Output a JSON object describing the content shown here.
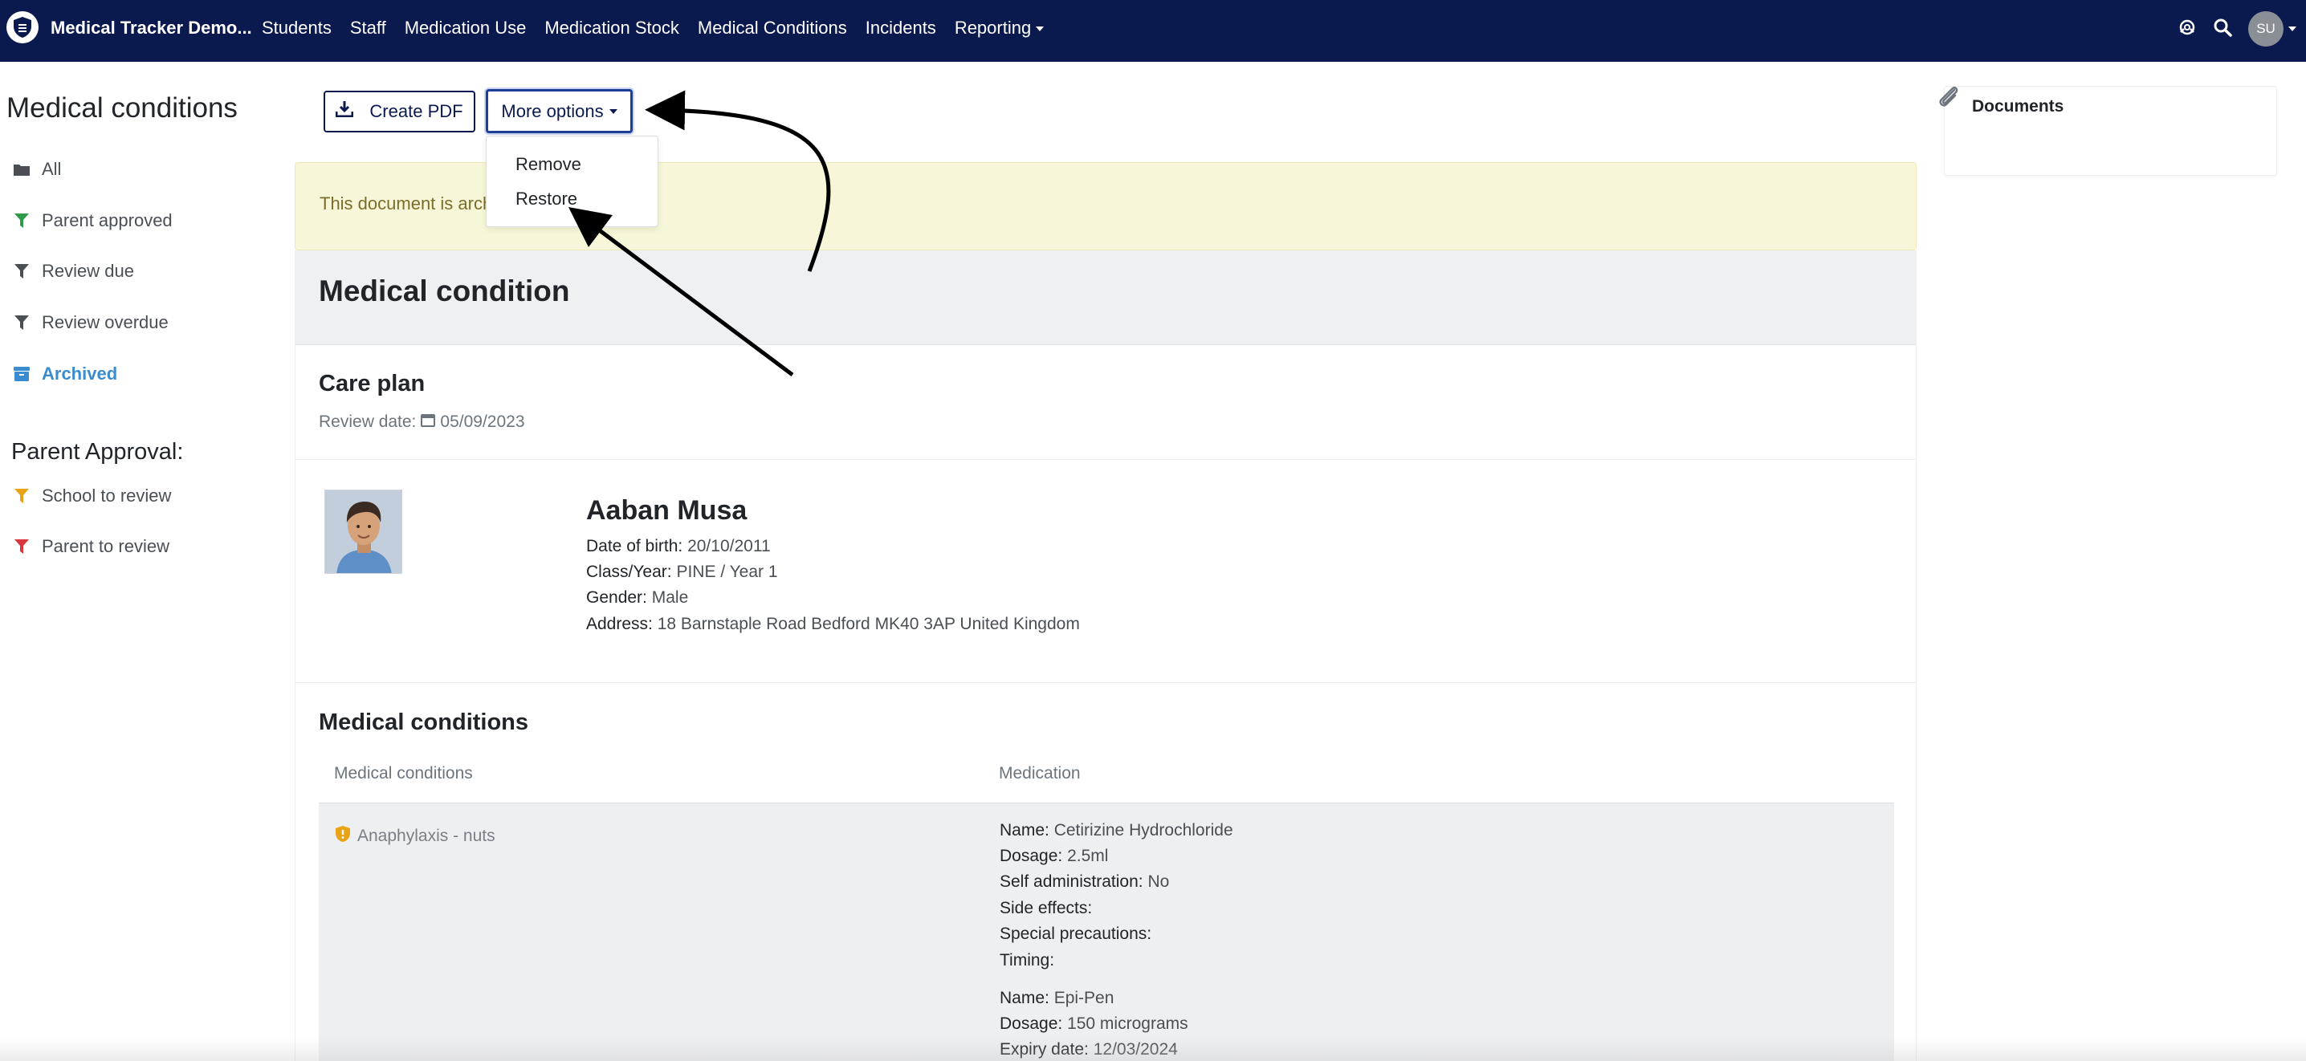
{
  "navbar": {
    "brand": "Medical Tracker Demo...",
    "links": [
      "Students",
      "Staff",
      "Medication Use",
      "Medication Stock",
      "Medical Conditions",
      "Incidents",
      "Reporting"
    ],
    "avatar_initials": "SU",
    "icons": [
      "shield-logo-icon",
      "help-icon",
      "search-icon"
    ]
  },
  "sidebar": {
    "title": "Medical conditions",
    "items": [
      {
        "label": "All",
        "icon": "folder-icon",
        "color": "#4a4f55"
      },
      {
        "label": "Parent approved",
        "icon": "filter-icon",
        "color": "#2e9a4a"
      },
      {
        "label": "Review due",
        "icon": "filter-icon",
        "color": "#4a4f55"
      },
      {
        "label": "Review overdue",
        "icon": "filter-icon",
        "color": "#4a4f55"
      },
      {
        "label": "Archived",
        "icon": "archive-icon",
        "color": "#3b8ccf"
      }
    ],
    "approval_heading": "Parent Approval:",
    "approval_items": [
      {
        "label": "School to review",
        "icon": "filter-icon",
        "color": "#e8a317"
      },
      {
        "label": "Parent to review",
        "icon": "filter-icon",
        "color": "#d9363e"
      }
    ]
  },
  "toolbar": {
    "create_pdf": "Create PDF",
    "more_options": "More options",
    "dropdown": [
      "Remove",
      "Restore"
    ]
  },
  "alert": {
    "text": "This document is arch"
  },
  "card": {
    "title": "Medical condition",
    "care_plan": "Care plan",
    "review_label": "Review date:",
    "review_date": "05/09/2023",
    "student": {
      "name": "Aaban Musa",
      "dob_label": "Date of birth:",
      "dob": "20/10/2011",
      "class_label": "Class/Year:",
      "class": "PINE / Year 1",
      "gender_label": "Gender:",
      "gender": "Male",
      "address_label": "Address:",
      "address": "18 Barnstaple Road Bedford MK40 3AP United Kingdom"
    },
    "conditions_title": "Medical conditions",
    "col_conditions": "Medical conditions",
    "col_medication": "Medication",
    "condition": "Anaphylaxis - nuts",
    "medications": [
      {
        "name_label": "Name:",
        "name": "Cetirizine Hydrochloride",
        "dosage_label": "Dosage:",
        "dosage": "2.5ml",
        "self_label": "Self administration:",
        "self": "No",
        "side_label": "Side effects:",
        "special_label": "Special precautions:",
        "timing_label": "Timing:"
      },
      {
        "name_label": "Name:",
        "name": "Epi-Pen",
        "dosage_label": "Dosage:",
        "dosage": "150 micrograms",
        "expiry_label": "Expiry date:",
        "expiry": "12/03/2024"
      }
    ]
  },
  "documents": {
    "title": "Documents"
  }
}
